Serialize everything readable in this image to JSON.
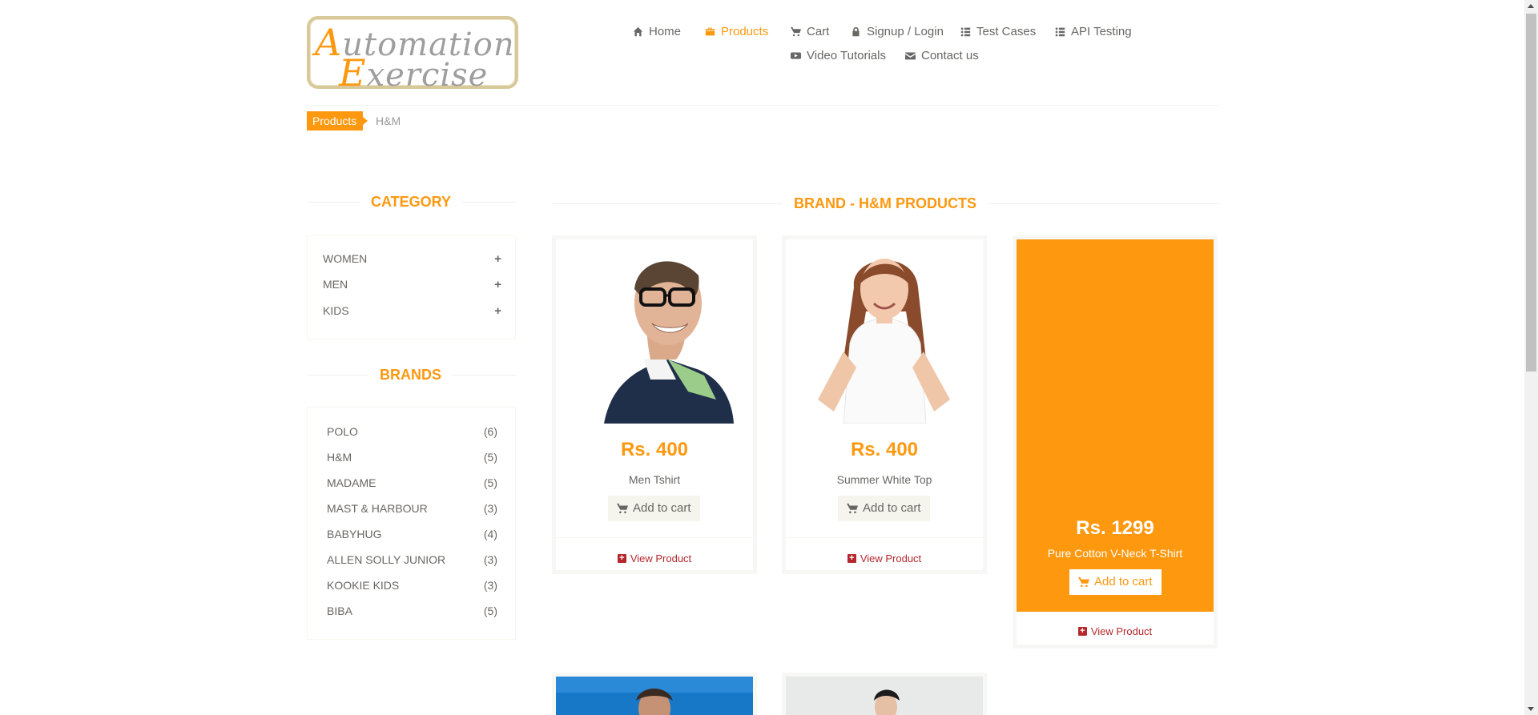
{
  "logo": {
    "line1_cap": "A",
    "line1_rest": "utomation",
    "line2_cap": "E",
    "line2_rest": "xercise"
  },
  "nav": [
    {
      "label": "Home",
      "icon": "home-icon"
    },
    {
      "label": "Products",
      "icon": "briefcase-icon",
      "active": true
    },
    {
      "label": "Cart",
      "icon": "cart-icon"
    },
    {
      "label": "Signup / Login",
      "icon": "lock-icon"
    },
    {
      "label": "Test Cases",
      "icon": "list-icon"
    },
    {
      "label": "API Testing",
      "icon": "list-icon"
    },
    {
      "label": "Video Tutorials",
      "icon": "youtube-icon"
    },
    {
      "label": "Contact us",
      "icon": "envelope-icon"
    }
  ],
  "breadcrumb": {
    "parent": "Products",
    "current": "H&M"
  },
  "sidebar": {
    "category_title": "CATEGORY",
    "categories": [
      {
        "label": "WOMEN",
        "toggle": "+"
      },
      {
        "label": "MEN",
        "toggle": "+"
      },
      {
        "label": "KIDS",
        "toggle": "+"
      }
    ],
    "brands_title": "BRANDS",
    "brands": [
      {
        "label": "POLO",
        "count": "(6)"
      },
      {
        "label": "H&M",
        "count": "(5)"
      },
      {
        "label": "MADAME",
        "count": "(5)"
      },
      {
        "label": "MAST & HARBOUR",
        "count": "(3)"
      },
      {
        "label": "BABYHUG",
        "count": "(4)"
      },
      {
        "label": "ALLEN SOLLY JUNIOR",
        "count": "(3)"
      },
      {
        "label": "KOOKIE KIDS",
        "count": "(3)"
      },
      {
        "label": "BIBA",
        "count": "(5)"
      }
    ]
  },
  "main": {
    "title": "BRAND - H&M PRODUCTS",
    "products": [
      {
        "price": "Rs. 400",
        "name": "Men Tshirt",
        "add_to_cart": "Add to cart",
        "view": "View Product"
      },
      {
        "price": "Rs. 400",
        "name": "Summer White Top",
        "add_to_cart": "Add to cart",
        "view": "View Product"
      },
      {
        "price": "Rs. 1299",
        "name": "Pure Cotton V-Neck T-Shirt",
        "add_to_cart": "Add to cart",
        "view": "View Product"
      }
    ]
  },
  "colors": {
    "accent": "#fe980f",
    "text": "#696763",
    "view_link": "#b4282d"
  }
}
